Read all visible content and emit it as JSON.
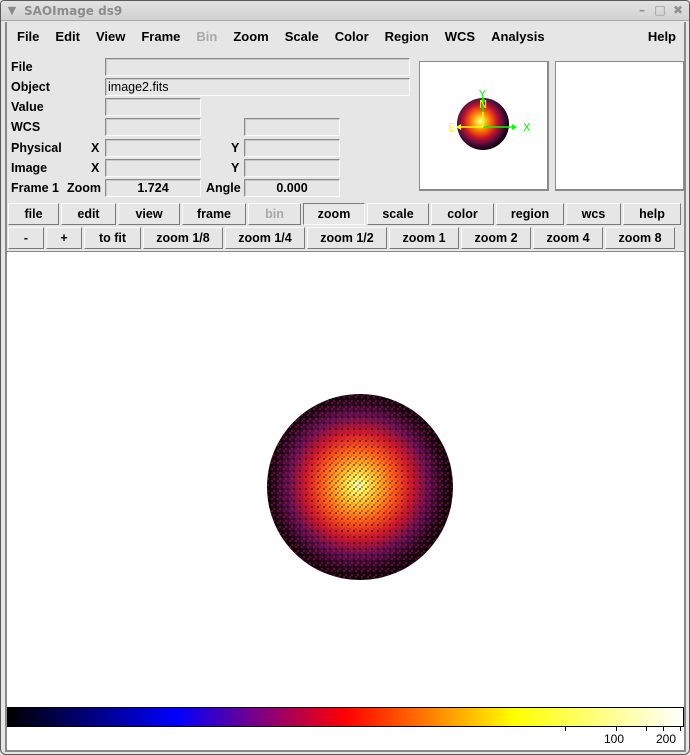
{
  "window": {
    "title": "SAOImage ds9",
    "controls": [
      "minimize",
      "maximize",
      "close"
    ]
  },
  "menubar": {
    "items": [
      {
        "label": "File",
        "enabled": true
      },
      {
        "label": "Edit",
        "enabled": true
      },
      {
        "label": "View",
        "enabled": true
      },
      {
        "label": "Frame",
        "enabled": true
      },
      {
        "label": "Bin",
        "enabled": false
      },
      {
        "label": "Zoom",
        "enabled": true
      },
      {
        "label": "Scale",
        "enabled": true
      },
      {
        "label": "Color",
        "enabled": true
      },
      {
        "label": "Region",
        "enabled": true
      },
      {
        "label": "WCS",
        "enabled": true
      },
      {
        "label": "Analysis",
        "enabled": true
      }
    ],
    "help": "Help"
  },
  "info": {
    "file_label": "File",
    "file_value": "",
    "object_label": "Object",
    "object_value": "image2.fits",
    "value_label": "Value",
    "value_value": "",
    "wcs_label": "WCS",
    "wcs_value1": "",
    "wcs_value2": "",
    "physical_label": "Physical",
    "physical_x_label": "X",
    "physical_x": "",
    "physical_y_label": "Y",
    "physical_y": "",
    "image_label": "Image",
    "image_x_label": "X",
    "image_x": "",
    "image_y_label": "Y",
    "image_y": "",
    "frame_label": "Frame 1",
    "zoom_label": "Zoom",
    "zoom_value": "1.724",
    "angle_label": "Angle",
    "angle_value": "0.000"
  },
  "panner": {
    "compass": {
      "north": "N",
      "east": "E",
      "x_axis": "X",
      "y_axis": "Y"
    },
    "compass_colors": {
      "wcs": "#ffff00",
      "image": "#00ff00"
    }
  },
  "buttonbar": {
    "main": [
      {
        "label": "file",
        "enabled": true,
        "active": false
      },
      {
        "label": "edit",
        "enabled": true,
        "active": false
      },
      {
        "label": "view",
        "enabled": true,
        "active": false
      },
      {
        "label": "frame",
        "enabled": true,
        "active": false
      },
      {
        "label": "bin",
        "enabled": false,
        "active": false
      },
      {
        "label": "zoom",
        "enabled": true,
        "active": true
      },
      {
        "label": "scale",
        "enabled": true,
        "active": false
      },
      {
        "label": "color",
        "enabled": true,
        "active": false
      },
      {
        "label": "region",
        "enabled": true,
        "active": false
      },
      {
        "label": "wcs",
        "enabled": true,
        "active": false
      },
      {
        "label": "help",
        "enabled": true,
        "active": false
      }
    ],
    "zoom": [
      {
        "label": "-"
      },
      {
        "label": "+"
      },
      {
        "label": "to fit"
      },
      {
        "label": "zoom 1/8"
      },
      {
        "label": "zoom 1/4"
      },
      {
        "label": "zoom 1/2"
      },
      {
        "label": "zoom 1"
      },
      {
        "label": "zoom 2"
      },
      {
        "label": "zoom 4"
      },
      {
        "label": "zoom 8"
      }
    ]
  },
  "colorbar": {
    "colormap": "heat-like (black-blue-red-yellow-white)",
    "stops": [
      "#000000",
      "#0000ff",
      "#ff0000",
      "#ffff00",
      "#ffffff"
    ],
    "labels": [
      "100",
      "200"
    ]
  }
}
